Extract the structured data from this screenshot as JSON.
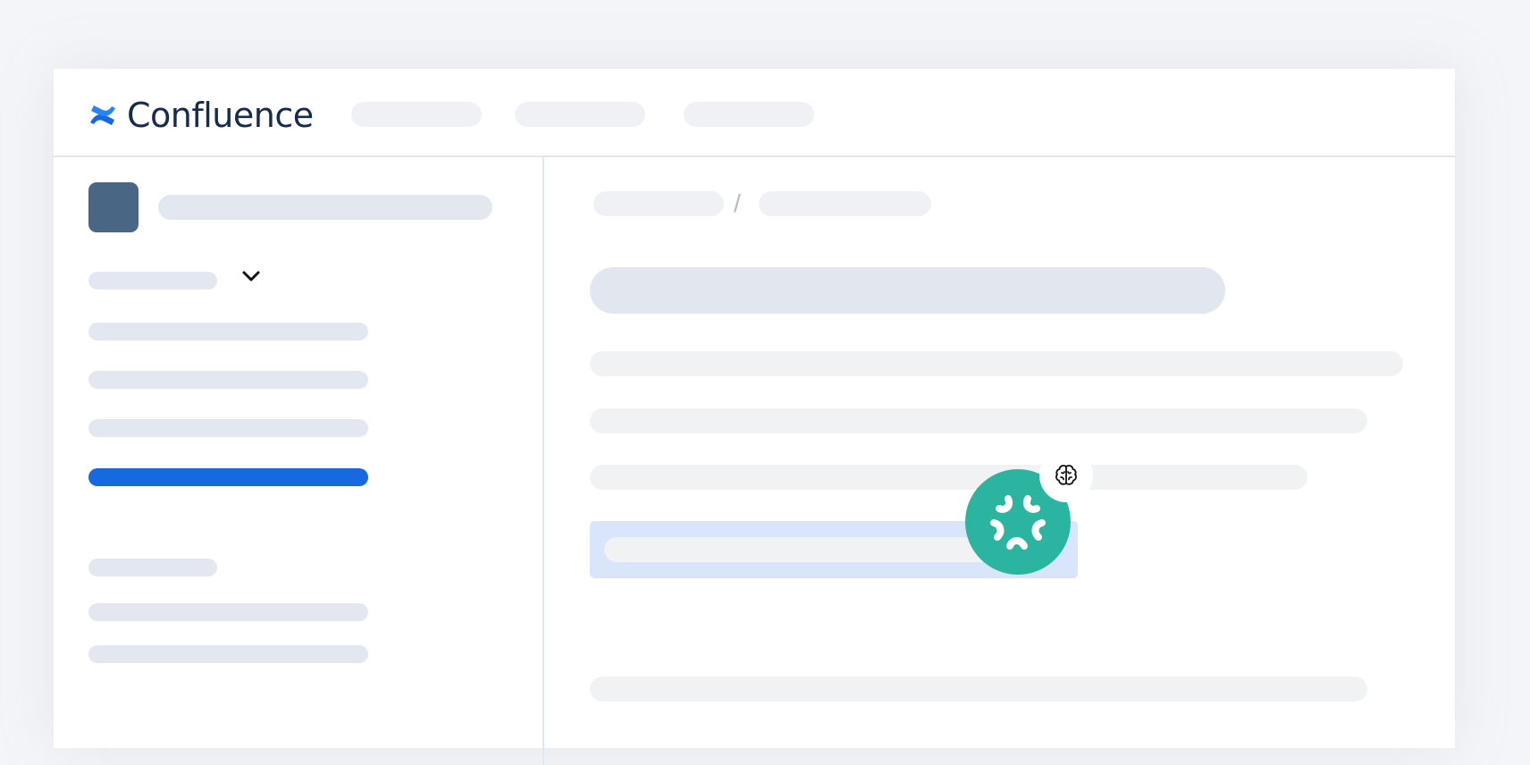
{
  "app": {
    "name": "Confluence",
    "brand_color": "#1769e0"
  },
  "icons": {
    "logo": "confluence-logo-icon",
    "chevron": "chevron-down-icon",
    "assistant": "ai-assistant-icon",
    "brain": "brain-icon"
  },
  "breadcrumb": {
    "separator": "/"
  },
  "colors": {
    "skeleton": "#e2e7f0",
    "active_item": "#1769e0",
    "assistant": "#2bb5a0",
    "highlight": "#d9e5fb"
  }
}
